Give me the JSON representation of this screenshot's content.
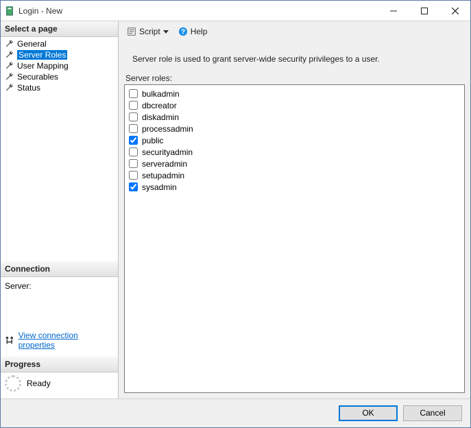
{
  "window": {
    "title": "Login - New"
  },
  "left": {
    "select_page_header": "Select a page",
    "nav": [
      {
        "label": "General",
        "selected": false
      },
      {
        "label": "Server Roles",
        "selected": true
      },
      {
        "label": "User Mapping",
        "selected": false
      },
      {
        "label": "Securables",
        "selected": false
      },
      {
        "label": "Status",
        "selected": false
      }
    ],
    "connection_header": "Connection",
    "server_label": "Server:",
    "view_connection_link": "View connection properties",
    "progress_header": "Progress",
    "progress_status": "Ready"
  },
  "toolbar": {
    "script_label": "Script",
    "help_label": "Help"
  },
  "main": {
    "description": "Server role is used to grant server-wide security privileges to a user.",
    "roles_label": "Server roles:",
    "roles": [
      {
        "name": "bulkadmin",
        "checked": false
      },
      {
        "name": "dbcreator",
        "checked": false
      },
      {
        "name": "diskadmin",
        "checked": false
      },
      {
        "name": "processadmin",
        "checked": false
      },
      {
        "name": "public",
        "checked": true
      },
      {
        "name": "securityadmin",
        "checked": false
      },
      {
        "name": "serveradmin",
        "checked": false
      },
      {
        "name": "setupadmin",
        "checked": false
      },
      {
        "name": "sysadmin",
        "checked": true
      }
    ]
  },
  "footer": {
    "ok_label": "OK",
    "cancel_label": "Cancel"
  }
}
